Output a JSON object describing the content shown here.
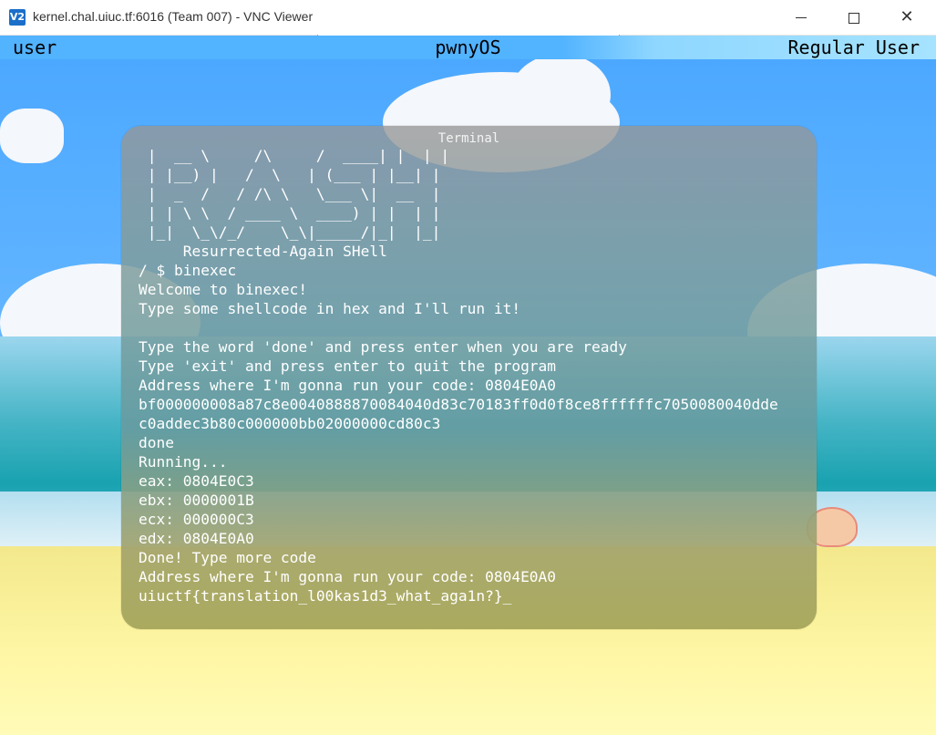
{
  "window": {
    "title": "kernel.chal.uiuc.tf:6016 (Team 007) - VNC Viewer",
    "app_icon": "V2",
    "controls": {
      "minimize_icon": "minimize-icon",
      "maximize_icon": "maximize-icon",
      "close_icon": "close-icon",
      "close_glyph": "✕"
    }
  },
  "os_bar": {
    "left": "user",
    "center": "pwnyOS",
    "right": "Regular User"
  },
  "terminal": {
    "title": "Terminal",
    "ascii_art": " |  __ \\     /\\     /  ____| |  | |\n | |__) |   /  \\   | (___ | |__| |\n |  _  /   / /\\ \\   \\___ \\|  __  |\n | | \\ \\  / ____ \\  ____) | |  | |\n |_|  \\_\\/_/    \\_\\|_____/|_|  |_|",
    "tagline": "     Resurrected-Again SHell",
    "lines": [
      "/ $ binexec",
      "Welcome to binexec!",
      "Type some shellcode in hex and I'll run it!",
      "",
      "Type the word 'done' and press enter when you are ready",
      "Type 'exit' and press enter to quit the program",
      "Address where I'm gonna run your code: 0804E0A0",
      "bf000000008a87c8e0040888870084040d83c70183ff0d0f8ce8ffffffc7050080040dde",
      "c0addec3b80c000000bb02000000cd80c3",
      "done",
      "Running...",
      "eax: 0804E0C3",
      "ebx: 0000001B",
      "ecx: 000000C3",
      "edx: 0804E0A0",
      "Done! Type more code",
      "Address where I'm gonna run your code: 0804E0A0",
      "uiuctf{translation_l00kas1d3_what_aga1n?}_"
    ]
  }
}
